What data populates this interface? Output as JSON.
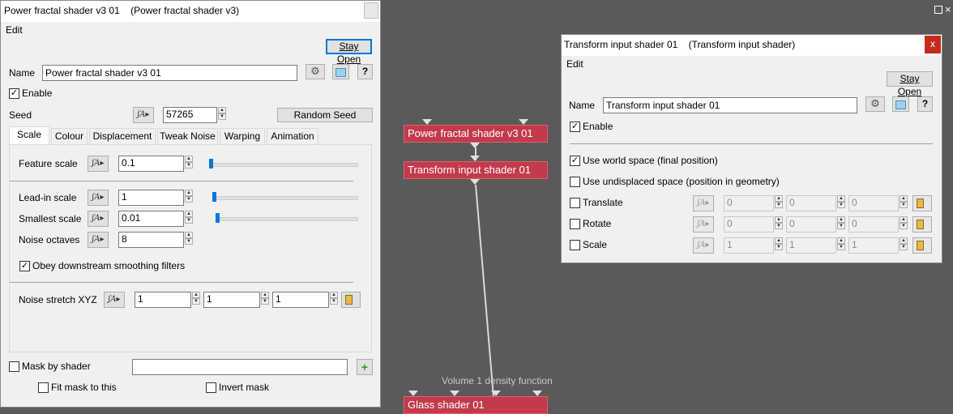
{
  "graph": {
    "nodes": [
      {
        "label": "Power fractal shader v3 01"
      },
      {
        "label": "Transform input shader 01"
      },
      {
        "label": "Glass shader 01"
      }
    ],
    "edge_label": "Volume 1 density function"
  },
  "left_window": {
    "title": "Power fractal shader v3 01    (Power fractal shader v3)",
    "menu": "Edit",
    "stay_open": "Stay Open",
    "name_label": "Name",
    "name_value": "Power fractal shader v3 01",
    "help": "?",
    "enable_label": "Enable",
    "seed_label": "Seed",
    "seed_value": "57265",
    "random_seed": "Random Seed",
    "tabs": [
      "Scale",
      "Colour",
      "Displacement",
      "Tweak Noise",
      "Warping",
      "Animation"
    ],
    "params": {
      "feature_scale": {
        "label": "Feature scale",
        "value": "0.1"
      },
      "lead_in_scale": {
        "label": "Lead-in scale",
        "value": "1"
      },
      "smallest_scale": {
        "label": "Smallest scale",
        "value": "0.01"
      },
      "noise_octaves": {
        "label": "Noise octaves",
        "value": "8"
      }
    },
    "obey_label": "Obey downstream smoothing filters",
    "noise_stretch": {
      "label": "Noise stretch XYZ",
      "x": "1",
      "y": "1",
      "z": "1"
    },
    "mask_label": "Mask by shader",
    "fit_mask_label": "Fit mask to this",
    "invert_mask_label": "Invert mask"
  },
  "right_window": {
    "title": "Transform input shader 01    (Transform input shader)",
    "close": "x",
    "menu": "Edit",
    "stay_open": "Stay Open",
    "name_label": "Name",
    "name_value": "Transform input shader 01",
    "help": "?",
    "enable_label": "Enable",
    "world_space_label": "Use world space (final position)",
    "undisplaced_label": "Use undisplaced space (position in geometry)",
    "translate": {
      "label": "Translate",
      "x": "0",
      "y": "0",
      "z": "0"
    },
    "rotate": {
      "label": "Rotate",
      "x": "0",
      "y": "0",
      "z": "0"
    },
    "scale": {
      "label": "Scale",
      "x": "1",
      "y": "1",
      "z": "1"
    }
  },
  "colors": {
    "node": "#c23a4b",
    "background": "#5a5a5a",
    "accent": "#0078d7"
  }
}
